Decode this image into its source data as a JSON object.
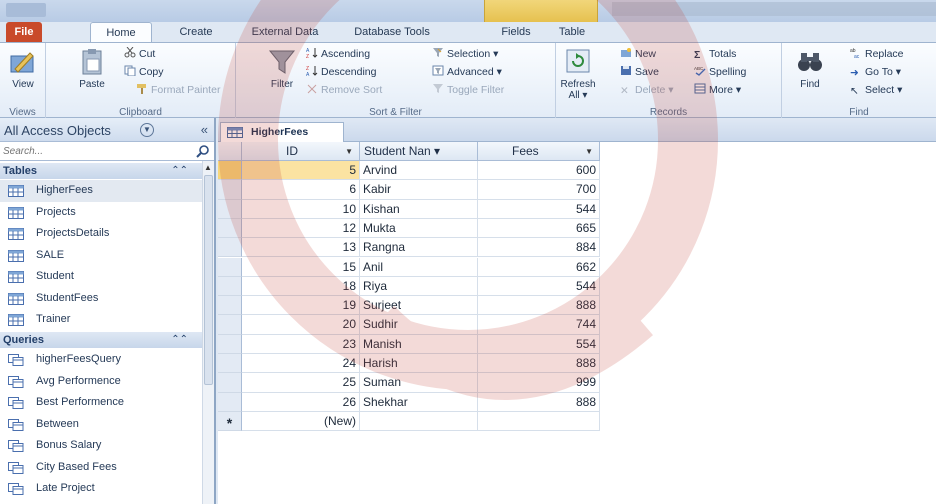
{
  "ribbon_tabs": {
    "file": "File",
    "home": "Home",
    "create": "Create",
    "external_data": "External Data",
    "database_tools": "Database Tools",
    "fields": "Fields",
    "table": "Table"
  },
  "ribbon": {
    "views": {
      "view": "View",
      "label": "Views"
    },
    "clipboard": {
      "paste": "Paste",
      "cut": "Cut",
      "copy": "Copy",
      "format_painter": "Format Painter",
      "label": "Clipboard"
    },
    "sort_filter": {
      "filter": "Filter",
      "ascending": "Ascending",
      "descending": "Descending",
      "remove_sort": "Remove Sort",
      "selection": "Selection ▾",
      "advanced": "Advanced ▾",
      "toggle_filter": "Toggle Filter",
      "label": "Sort & Filter"
    },
    "records": {
      "refresh": "Refresh",
      "refresh_all": "All ▾",
      "new": "New",
      "save": "Save",
      "delete": "Delete ▾",
      "totals": "Totals",
      "spelling": "Spelling",
      "more": "More ▾",
      "label": "Records"
    },
    "find": {
      "find": "Find",
      "replace": "Replace",
      "goto": "Go To ▾",
      "select": "Select ▾",
      "label": "Find"
    }
  },
  "nav": {
    "title": "All Access Objects",
    "collapse": "«",
    "search_placeholder": "Search...",
    "tables_label": "Tables",
    "tables": [
      "HigherFees",
      "Projects",
      "ProjectsDetails",
      "SALE",
      "Student",
      "StudentFees",
      "Trainer"
    ],
    "queries_label": "Queries",
    "queries": [
      "higherFeesQuery",
      "Avg Performence",
      "Best Performence",
      "Between",
      "Bonus Salary",
      "City Based Fees",
      "Late Project"
    ]
  },
  "document": {
    "tab_title": "HigherFees",
    "columns": [
      "ID",
      "Student Nan ▾",
      "Fees"
    ],
    "rows": [
      {
        "id": "5",
        "name": "Arvind",
        "fees": "600"
      },
      {
        "id": "6",
        "name": "Kabir",
        "fees": "700"
      },
      {
        "id": "10",
        "name": "Kishan",
        "fees": "544"
      },
      {
        "id": "12",
        "name": "Mukta",
        "fees": "665"
      },
      {
        "id": "13",
        "name": "Rangna",
        "fees": "884"
      },
      {
        "id": "15",
        "name": "Anil",
        "fees": "662"
      },
      {
        "id": "18",
        "name": "Riya",
        "fees": "544"
      },
      {
        "id": "19",
        "name": "Surjeet",
        "fees": "888"
      },
      {
        "id": "20",
        "name": "Sudhir",
        "fees": "744"
      },
      {
        "id": "23",
        "name": "Manish",
        "fees": "554"
      },
      {
        "id": "24",
        "name": "Harish",
        "fees": "888"
      },
      {
        "id": "25",
        "name": "Suman",
        "fees": "999"
      },
      {
        "id": "26",
        "name": "Shekhar",
        "fees": "888"
      }
    ],
    "new_row_marker": "*",
    "new_row_label": "(New)"
  },
  "colors": {
    "file_tab": "#c94a2a",
    "context_tab": "#e6c14f",
    "current_row": "#f7d77a",
    "ribbon_bg": "#e3ecf7",
    "nav_section": "#c7d6ea"
  }
}
